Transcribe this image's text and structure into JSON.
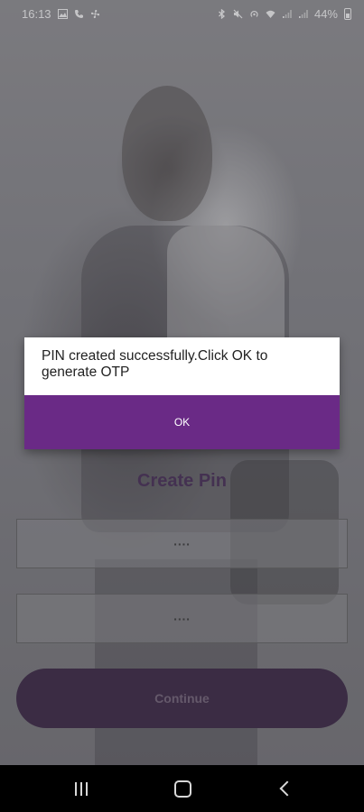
{
  "status_bar": {
    "time": "16:13",
    "battery_percent": "44%",
    "left_icons": [
      "image-icon",
      "phone-icon",
      "fan-icon"
    ],
    "right_icons": [
      "bluetooth-icon",
      "mute-icon",
      "hotspot-icon",
      "wifi-icon",
      "signal-icon",
      "signal-icon",
      "battery-icon"
    ]
  },
  "dialog": {
    "message": "PIN created successfully.Click OK to generate OTP",
    "ok_label": "OK"
  },
  "form": {
    "title": "Create Pin",
    "pin_value": "····",
    "confirm_pin_value": "····",
    "continue_label": "Continue"
  },
  "colors": {
    "accent": "#6a2a86",
    "button_dark": "#2b1536",
    "title": "#3a1c4a"
  },
  "nav_bar": {
    "icons": [
      "recents-icon",
      "home-icon",
      "back-icon"
    ]
  }
}
